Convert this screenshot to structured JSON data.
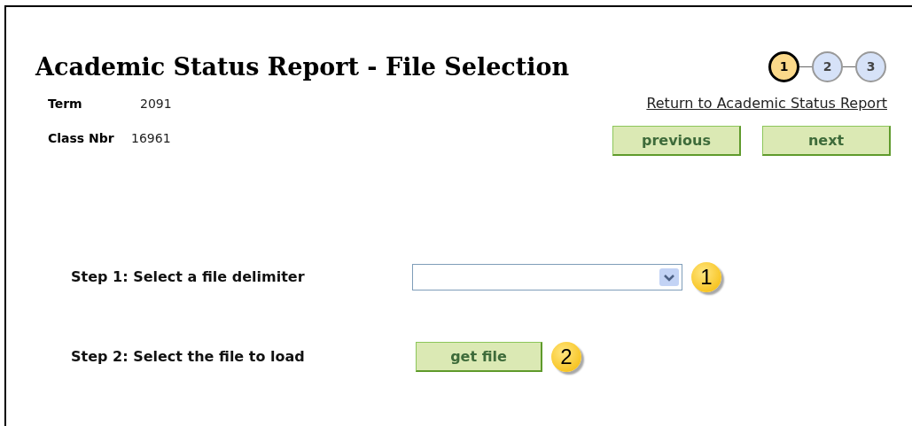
{
  "title": "Academic Status Report - File Selection",
  "steps": [
    {
      "label": "1",
      "selected": true
    },
    {
      "label": "2",
      "selected": false
    },
    {
      "label": "3",
      "selected": false
    }
  ],
  "fields": [
    {
      "label": "Term",
      "value": "2091"
    },
    {
      "label": "Class Nbr",
      "value": "16961"
    }
  ],
  "return_link": "Return to Academic Status Report",
  "nav_buttons": [
    "previous",
    "next"
  ],
  "form_steps": [
    {
      "kind": "select",
      "label": "Step 1: Select a file delimiter",
      "callout": "1"
    },
    {
      "kind": "button",
      "label": "Step 2: Select the file to load",
      "button": "get file",
      "callout": "2"
    }
  ]
}
